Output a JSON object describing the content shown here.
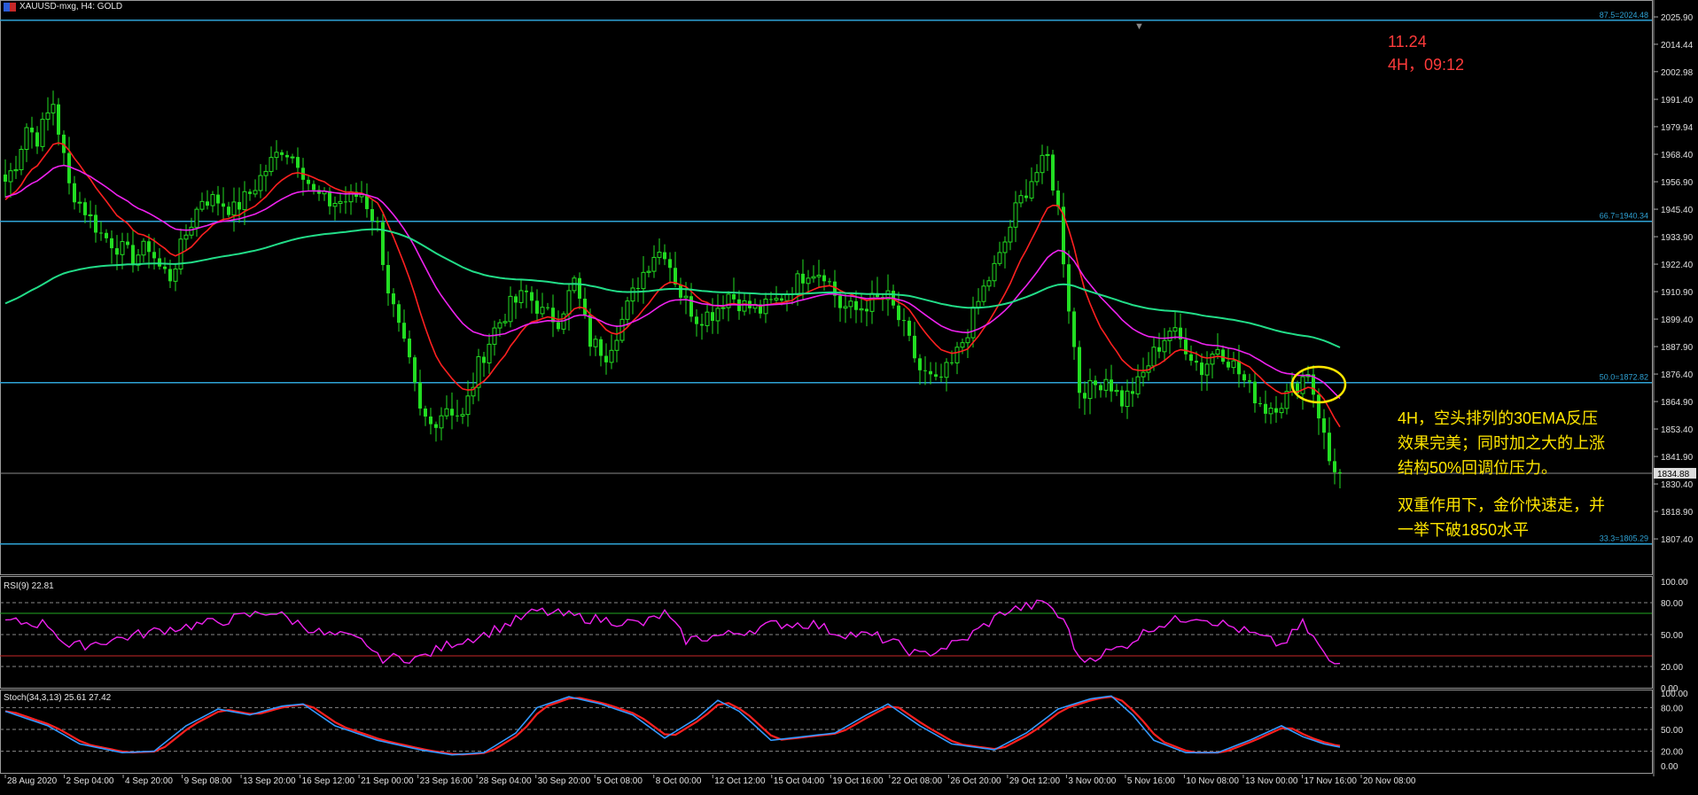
{
  "window": {
    "title": "XAUUSD-mxg, H4:  GOLD",
    "arrow_marker": "▼"
  },
  "price_axis": {
    "min": 1800,
    "max": 2030,
    "ticks": [
      "2025.90",
      "2014.44",
      "2002.98",
      "1991.40",
      "1979.94",
      "1968.40",
      "1956.90",
      "1945.40",
      "1933.90",
      "1922.40",
      "1910.90",
      "1899.40",
      "1887.90",
      "1876.40",
      "1864.90",
      "1853.40",
      "1841.90",
      "1830.40",
      "1818.90",
      "1807.40"
    ],
    "tick_values": [
      2025.9,
      2014.44,
      2002.98,
      1991.4,
      1979.94,
      1968.4,
      1956.9,
      1945.4,
      1933.9,
      1922.4,
      1910.9,
      1899.4,
      1887.9,
      1876.4,
      1864.9,
      1853.4,
      1841.9,
      1830.4,
      1818.9,
      1807.4
    ]
  },
  "fib_levels": [
    {
      "label": "87.5=2024.48",
      "value": 2024.48
    },
    {
      "label": "66.7=1940.34",
      "value": 1940.34
    },
    {
      "label": "50.0=1872.82",
      "value": 1872.82
    },
    {
      "label": "33.3=1805.29",
      "value": 1805.29
    }
  ],
  "current_price": {
    "label": "1834.88",
    "value": 1834.88
  },
  "time_axis": [
    "28 Aug 2020",
    "2 Sep 04:00",
    "4 Sep 20:00",
    "9 Sep 08:00",
    "13 Sep 20:00",
    "16 Sep 12:00",
    "21 Sep 00:00",
    "23 Sep 16:00",
    "28 Sep 04:00",
    "30 Sep 20:00",
    "5 Oct 08:00",
    "8 Oct 00:00",
    "12 Oct 12:00",
    "15 Oct 04:00",
    "19 Oct 16:00",
    "22 Oct 08:00",
    "26 Oct 20:00",
    "29 Oct 12:00",
    "3 Nov 00:00",
    "5 Nov 16:00",
    "10 Nov 08:00",
    "13 Nov 00:00",
    "17 Nov 16:00",
    "20 Nov 08:00"
  ],
  "note": {
    "date": "11.24",
    "time": "4H，09:12"
  },
  "annotation": {
    "line1": "4H，空头排列的30EMA反压",
    "line2": "效果完美；同时加之大的上涨",
    "line3": "结构50%回调位压力。",
    "line4": "双重作用下，金价快速走，并",
    "line5": "一举下破1850水平"
  },
  "rsi": {
    "label": "RSI(9) 22.81",
    "levels": [
      100,
      80,
      70,
      50,
      30,
      20,
      0
    ],
    "level_labels": [
      "100.00",
      "80.00",
      "50.00",
      "20.00",
      "0.00"
    ],
    "current": 22.81
  },
  "stoch": {
    "label": "Stoch(34,3,13) 25.61 27.42",
    "level_labels": [
      "100.00",
      "80.00",
      "50.00",
      "20.00",
      "0.00"
    ],
    "k": 25.61,
    "d": 27.42
  },
  "colors": {
    "background": "#000000",
    "candle": "#22dd22",
    "ema_fast": "#ff2020",
    "ema_mid": "#ee22ee",
    "ema_slow": "#22dd88",
    "fib": "#2fa3d6",
    "rsi_line": "#ee22ee",
    "stoch_main": "#3399ff",
    "stoch_signal": "#ff2020",
    "note": "#ff3b3b",
    "annotation": "#ffe600",
    "highlight_circle": "#ffe600"
  },
  "price_path": [
    [
      0,
      1957
    ],
    [
      2,
      1965
    ],
    [
      4,
      1980
    ],
    [
      6,
      1975
    ],
    [
      9,
      1990
    ],
    [
      12,
      1955
    ],
    [
      15,
      1945
    ],
    [
      18,
      1935
    ],
    [
      21,
      1930
    ],
    [
      24,
      1925
    ],
    [
      27,
      1930
    ],
    [
      29,
      1921
    ],
    [
      31,
      1917
    ],
    [
      34,
      1935
    ],
    [
      37,
      1950
    ],
    [
      40,
      1949
    ],
    [
      43,
      1945
    ],
    [
      46,
      1952
    ],
    [
      49,
      1962
    ],
    [
      52,
      1971
    ],
    [
      55,
      1966
    ],
    [
      58,
      1952
    ],
    [
      61,
      1948
    ],
    [
      64,
      1949
    ],
    [
      67,
      1952
    ],
    [
      70,
      1938
    ],
    [
      72,
      1912
    ],
    [
      74,
      1895
    ],
    [
      76,
      1880
    ],
    [
      78,
      1860
    ],
    [
      80,
      1855
    ],
    [
      83,
      1863
    ],
    [
      86,
      1858
    ],
    [
      89,
      1880
    ],
    [
      92,
      1895
    ],
    [
      95,
      1905
    ],
    [
      98,
      1910
    ],
    [
      101,
      1902
    ],
    [
      104,
      1899
    ],
    [
      107,
      1915
    ],
    [
      110,
      1890
    ],
    [
      113,
      1885
    ],
    [
      116,
      1899
    ],
    [
      119,
      1915
    ],
    [
      122,
      1927
    ],
    [
      124,
      1928
    ],
    [
      127,
      1910
    ],
    [
      130,
      1900
    ],
    [
      133,
      1902
    ],
    [
      136,
      1910
    ],
    [
      139,
      1905
    ],
    [
      142,
      1903
    ],
    [
      145,
      1907
    ],
    [
      148,
      1913
    ],
    [
      151,
      1920
    ],
    [
      154,
      1919
    ],
    [
      157,
      1905
    ],
    [
      160,
      1903
    ],
    [
      163,
      1907
    ],
    [
      166,
      1908
    ],
    [
      169,
      1895
    ],
    [
      172,
      1878
    ],
    [
      175,
      1872
    ],
    [
      178,
      1880
    ],
    [
      181,
      1895
    ],
    [
      184,
      1912
    ],
    [
      187,
      1925
    ],
    [
      190,
      1945
    ],
    [
      193,
      1958
    ],
    [
      196,
      1967
    ],
    [
      198,
      1945
    ],
    [
      200,
      1905
    ],
    [
      202,
      1870
    ],
    [
      204,
      1870
    ],
    [
      207,
      1875
    ],
    [
      210,
      1865
    ],
    [
      213,
      1872
    ],
    [
      216,
      1885
    ],
    [
      219,
      1895
    ],
    [
      222,
      1888
    ],
    [
      225,
      1878
    ],
    [
      228,
      1888
    ],
    [
      231,
      1880
    ],
    [
      234,
      1870
    ],
    [
      237,
      1862
    ],
    [
      240,
      1865
    ],
    [
      243,
      1872
    ],
    [
      245,
      1878
    ],
    [
      247,
      1860
    ],
    [
      249,
      1840
    ],
    [
      251,
      1834.88
    ]
  ],
  "rsi_path": [
    [
      0,
      62
    ],
    [
      8,
      60
    ],
    [
      12,
      38
    ],
    [
      20,
      45
    ],
    [
      30,
      55
    ],
    [
      40,
      62
    ],
    [
      50,
      72
    ],
    [
      60,
      50
    ],
    [
      64,
      48
    ],
    [
      68,
      42
    ],
    [
      70,
      28
    ],
    [
      78,
      28
    ],
    [
      84,
      42
    ],
    [
      90,
      50
    ],
    [
      100,
      72
    ],
    [
      110,
      65
    ],
    [
      120,
      60
    ],
    [
      124,
      70
    ],
    [
      128,
      45
    ],
    [
      136,
      50
    ],
    [
      145,
      60
    ],
    [
      152,
      60
    ],
    [
      156,
      52
    ],
    [
      164,
      48
    ],
    [
      168,
      40
    ],
    [
      172,
      30
    ],
    [
      180,
      44
    ],
    [
      188,
      72
    ],
    [
      196,
      80
    ],
    [
      200,
      55
    ],
    [
      202,
      25
    ],
    [
      210,
      38
    ],
    [
      216,
      58
    ],
    [
      224,
      68
    ],
    [
      232,
      55
    ],
    [
      240,
      40
    ],
    [
      244,
      60
    ],
    [
      247,
      40
    ],
    [
      249,
      22.81
    ],
    [
      251,
      22.81
    ]
  ],
  "stoch_path": [
    [
      0,
      75
    ],
    [
      8,
      55
    ],
    [
      14,
      30
    ],
    [
      22,
      18
    ],
    [
      28,
      20
    ],
    [
      34,
      55
    ],
    [
      40,
      78
    ],
    [
      46,
      70
    ],
    [
      52,
      82
    ],
    [
      56,
      85
    ],
    [
      62,
      55
    ],
    [
      70,
      35
    ],
    [
      78,
      22
    ],
    [
      84,
      15
    ],
    [
      90,
      18
    ],
    [
      96,
      45
    ],
    [
      100,
      80
    ],
    [
      106,
      95
    ],
    [
      112,
      85
    ],
    [
      118,
      70
    ],
    [
      124,
      38
    ],
    [
      130,
      65
    ],
    [
      134,
      90
    ],
    [
      138,
      75
    ],
    [
      144,
      35
    ],
    [
      150,
      40
    ],
    [
      156,
      45
    ],
    [
      162,
      70
    ],
    [
      166,
      85
    ],
    [
      172,
      55
    ],
    [
      178,
      30
    ],
    [
      186,
      22
    ],
    [
      192,
      45
    ],
    [
      198,
      78
    ],
    [
      204,
      92
    ],
    [
      208,
      96
    ],
    [
      212,
      70
    ],
    [
      216,
      35
    ],
    [
      222,
      18
    ],
    [
      228,
      18
    ],
    [
      234,
      35
    ],
    [
      240,
      55
    ],
    [
      244,
      40
    ],
    [
      248,
      30
    ],
    [
      251,
      25.61
    ]
  ]
}
